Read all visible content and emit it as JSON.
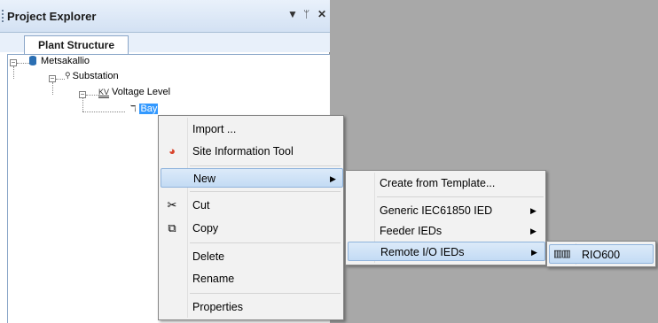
{
  "panel": {
    "title": "Project Explorer",
    "pin_glyph": "▼ ᛘ ✕",
    "tab": "Plant Structure"
  },
  "tree": {
    "root": "Metsakallio",
    "substation": "Substation",
    "voltage_level": "Voltage Level",
    "voltage_icon_text": "KV",
    "bay": "Bay"
  },
  "context_menu": {
    "import": "Import ...",
    "site_info": "Site Information Tool",
    "new": "New",
    "cut": "Cut",
    "copy": "Copy",
    "delete": "Delete",
    "rename": "Rename",
    "properties": "Properties"
  },
  "submenu_new": {
    "create_from_template": "Create from Template...",
    "generic_ied": "Generic IEC61850 IED",
    "feeder_ieds": "Feeder IEDs",
    "remote_io_ieds": "Remote I/O IEDs"
  },
  "submenu_remote_io": {
    "rio600": "RIO600"
  },
  "colors": {
    "highlight": "#c3dbf4",
    "selection": "#3399ff",
    "workspace": "#a8a8a8"
  }
}
